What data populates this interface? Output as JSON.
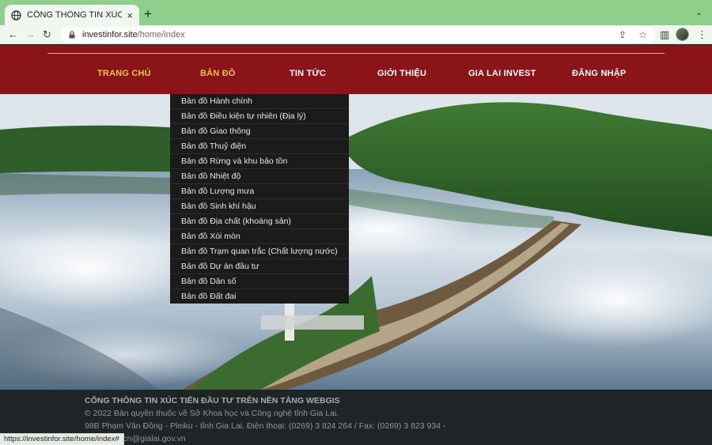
{
  "browser": {
    "tab_title": "CỔNG THÔNG TIN XÚC TIẾN Đ",
    "tab_close": "×",
    "new_tab": "+",
    "tab_menu": "⌄",
    "back": "←",
    "forward": "→",
    "reload": "↻",
    "url_host": "investinfor.site",
    "url_path": "/home/index",
    "share_glyph": "⇪",
    "star_glyph": "☆",
    "sidepanel_glyph": "▥",
    "menu_glyph": "⋮"
  },
  "nav": {
    "items": [
      {
        "label": "TRANG CHỦ",
        "active": true
      },
      {
        "label": "BẢN ĐỒ",
        "active": true
      },
      {
        "label": "TIN TỨC",
        "active": false
      },
      {
        "label": "GIỚI THIỆU",
        "active": false
      },
      {
        "label": "GIA LAI INVEST",
        "active": false
      },
      {
        "label": "ĐĂNG NHẬP",
        "active": false
      }
    ],
    "active_color": "#e6c94a"
  },
  "dropdown": {
    "items": [
      "Bản đồ Hành chính",
      "Bản đồ Điều kiện tự nhiên (Địa lý)",
      "Bản đồ Giao thông",
      "Bản đồ Thuỷ điện",
      "Bản đồ Rừng và khu bảo tồn",
      "Bản đồ Nhiệt độ",
      "Bản đồ Lượng mưa",
      "Bản đồ Sinh khí hậu",
      "Bản đồ Địa chất (khoáng sản)",
      "Bản đồ Xói mòn",
      "Bản đồ Trạm quan trắc (Chất lượng nước)",
      "Bản đồ Dự án đầu tư",
      "Bản đồ Dân số",
      "Bản đồ Đất đai"
    ]
  },
  "footer": {
    "title": "CỔNG THÔNG TIN XÚC TIẾN ĐẦU TƯ TRÊN NỀN TẢNG WEBGIS",
    "copyright": "© 2022 Bản quyền thuộc về Sở Khoa học và Công nghệ tỉnh Gia Lai.",
    "address": "98B Phạm Văn Đồng - Pleiku - tỉnh Gia Lai. Điện thoại: (0269) 3 824 264 / Fax: (0269) 3 823 934 -",
    "email": "Email: skhcn@gialai.gov.vn"
  },
  "status_url": "https://investinfor.site/home/index#",
  "colors": {
    "nav_bg": "#8a1418",
    "chrome_frame": "#8ecf8b",
    "dropdown_bg": "#1b1b1b",
    "footer_bg": "#1f2426"
  }
}
